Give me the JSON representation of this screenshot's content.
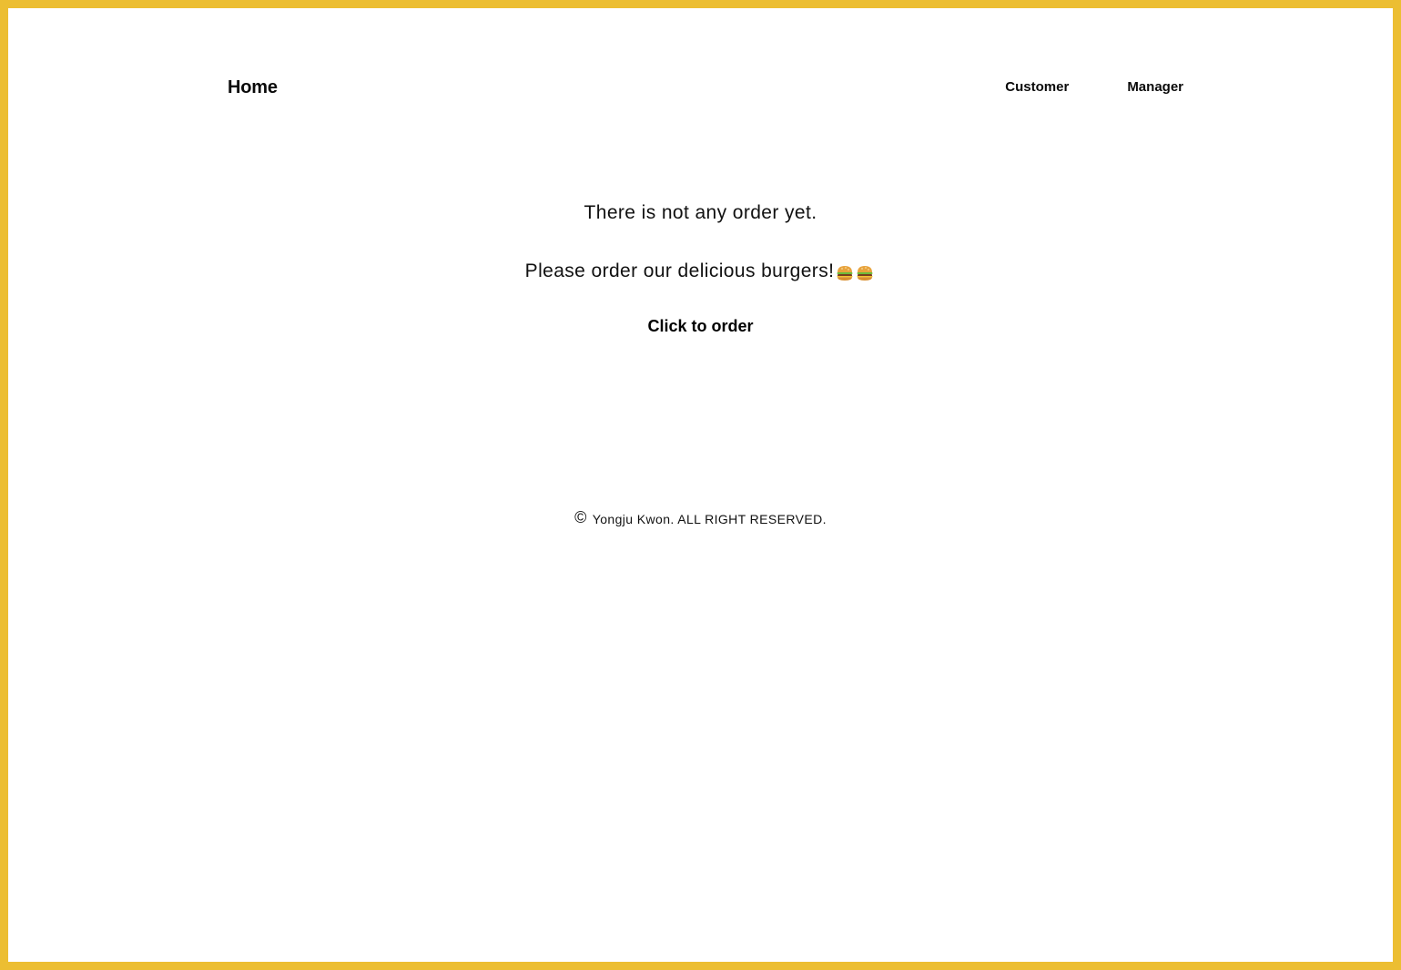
{
  "nav": {
    "home_label": "Home",
    "links": [
      {
        "label": "Customer"
      },
      {
        "label": "Manager"
      }
    ]
  },
  "empty_state": {
    "message": "There is not any order yet.",
    "prompt": "Please order our delicious burgers!",
    "prompt_icons": [
      "burger-icon",
      "burger-icon"
    ],
    "order_button_label": "Click to order"
  },
  "footer": {
    "copyright_symbol": "©",
    "text": "Yongju Kwon. ALL RIGHT RESERVED."
  },
  "colors": {
    "frame_border": "#ECBE32",
    "background": "#FFFFFF",
    "text": "#111111"
  }
}
